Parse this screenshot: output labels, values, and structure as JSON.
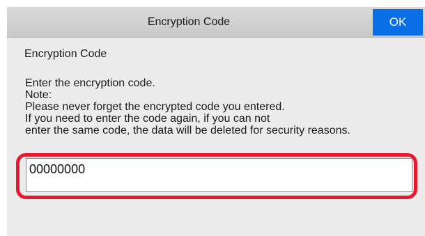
{
  "header": {
    "title": "Encryption Code",
    "ok_label": "OK"
  },
  "content": {
    "section_label": "Encryption Code",
    "instructions": [
      "Enter the encryption code.",
      "Note:",
      "Please never forget the encrypted code you entered.",
      "If you need to enter the code again,  if you can not",
      "enter the same code, the data will be deleted for security reasons."
    ],
    "code_input": {
      "value": "00000000"
    }
  },
  "colors": {
    "ok_button": "#0a6fe6",
    "highlight": "#e8182d",
    "background": "#ececec"
  }
}
